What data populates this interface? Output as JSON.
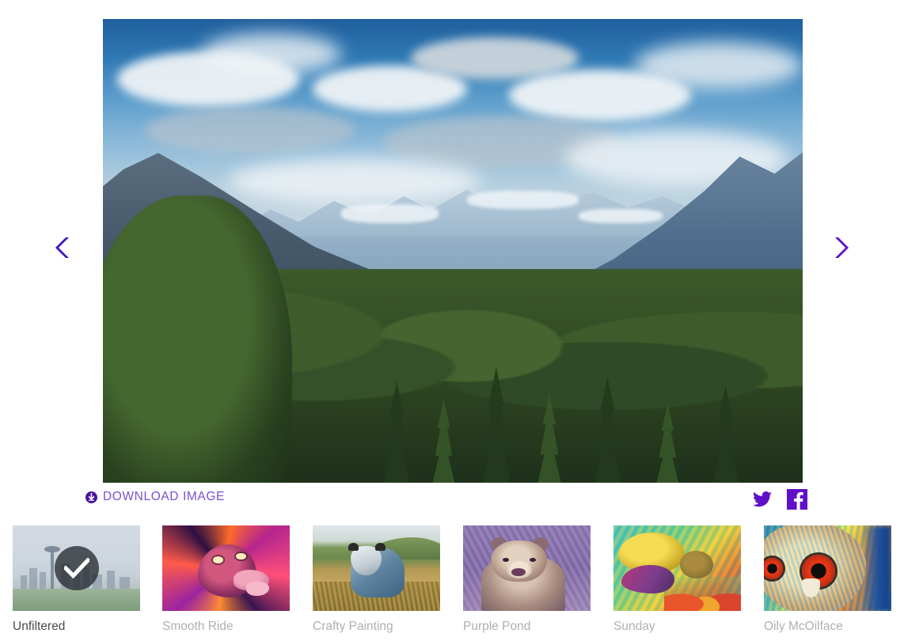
{
  "viewer": {
    "alt": "Mountain valley landscape with evergreen forest, snow-capped peaks and clouds",
    "prev_label": "Previous image",
    "next_label": "Next image",
    "prev_icon": "chevron-left-icon",
    "next_icon": "chevron-right-icon"
  },
  "actions": {
    "download_label": "DOWNLOAD IMAGE",
    "download_icon": "download-circle-icon",
    "twitter_label": "Share on Twitter",
    "twitter_icon": "twitter-icon",
    "facebook_label": "Share on Facebook",
    "facebook_icon": "facebook-icon"
  },
  "colors": {
    "accent": "#5f10c8",
    "link": "#7a4fd0",
    "label_active": "#4a4a4e",
    "label_inactive": "#b0b0b4",
    "page_background": "#ffffff"
  },
  "filters": [
    {
      "label": "Unfiltered",
      "selected": true,
      "check_icon": "check-icon",
      "art": "art-city"
    },
    {
      "label": "Smooth Ride",
      "selected": false,
      "check_icon": "",
      "art": "art-dog"
    },
    {
      "label": "Crafty Painting",
      "selected": false,
      "check_icon": "",
      "art": "art-cow"
    },
    {
      "label": "Purple Pond",
      "selected": false,
      "check_icon": "",
      "art": "art-bear"
    },
    {
      "label": "Sunday",
      "selected": false,
      "check_icon": "",
      "art": "art-turtle"
    },
    {
      "label": "Oily McOilface",
      "selected": false,
      "check_icon": "",
      "art": "art-owl"
    }
  ]
}
